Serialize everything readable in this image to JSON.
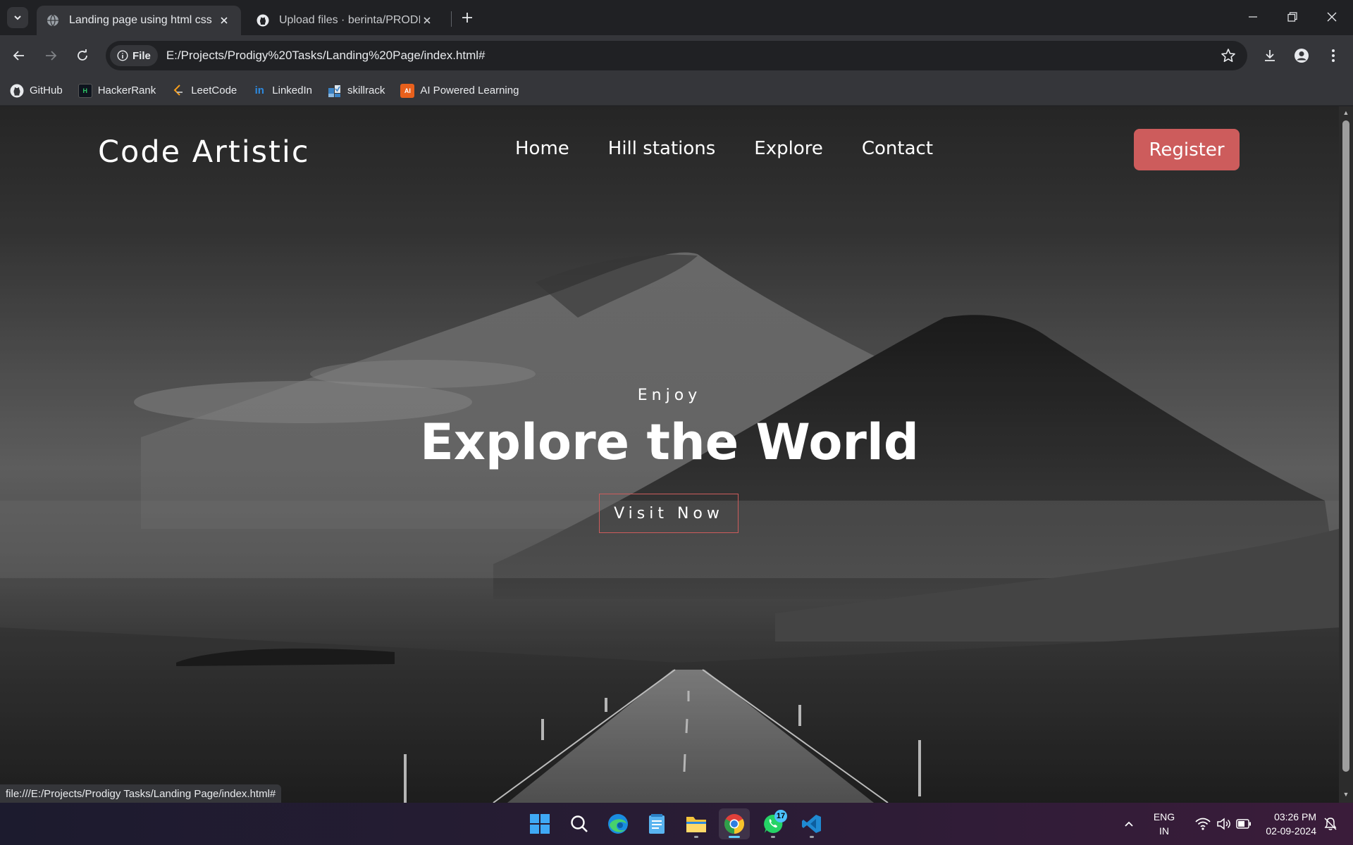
{
  "browser": {
    "tabs": [
      {
        "title": "Landing page using html css",
        "active": true
      },
      {
        "title": "Upload files · berinta/PRODIGY_",
        "active": false
      }
    ],
    "site_chip": "File",
    "url": "E:/Projects/Prodigy%20Tasks/Landing%20Page/index.html#",
    "bookmarks": [
      {
        "label": "GitHub",
        "icon": "github-icon"
      },
      {
        "label": "HackerRank",
        "icon": "hackerrank-icon"
      },
      {
        "label": "LeetCode",
        "icon": "leetcode-icon"
      },
      {
        "label": "LinkedIn",
        "icon": "linkedin-icon"
      },
      {
        "label": "skillrack",
        "icon": "skillrack-icon"
      },
      {
        "label": "AI Powered Learning",
        "icon": "ai-learning-icon"
      }
    ],
    "status_url": "file:///E:/Projects/Prodigy Tasks/Landing Page/index.html#"
  },
  "page": {
    "logo": "Code Artistic",
    "nav": [
      "Home",
      "Hill stations",
      "Explore",
      "Contact"
    ],
    "register": "Register",
    "kicker": "Enjoy",
    "headline": "Explore the World",
    "cta": "Visit Now",
    "colors": {
      "accent": "#cd5c5c",
      "text": "#ffffff"
    }
  },
  "taskbar": {
    "apps": [
      "start-icon",
      "search-icon",
      "edge-icon",
      "notepad-icon",
      "file-explorer-icon",
      "chrome-icon",
      "whatsapp-icon",
      "vscode-icon"
    ],
    "whatsapp_badge": "17",
    "lang_line1": "ENG",
    "lang_line2": "IN",
    "time": "03:26 PM",
    "date": "02-09-2024"
  }
}
